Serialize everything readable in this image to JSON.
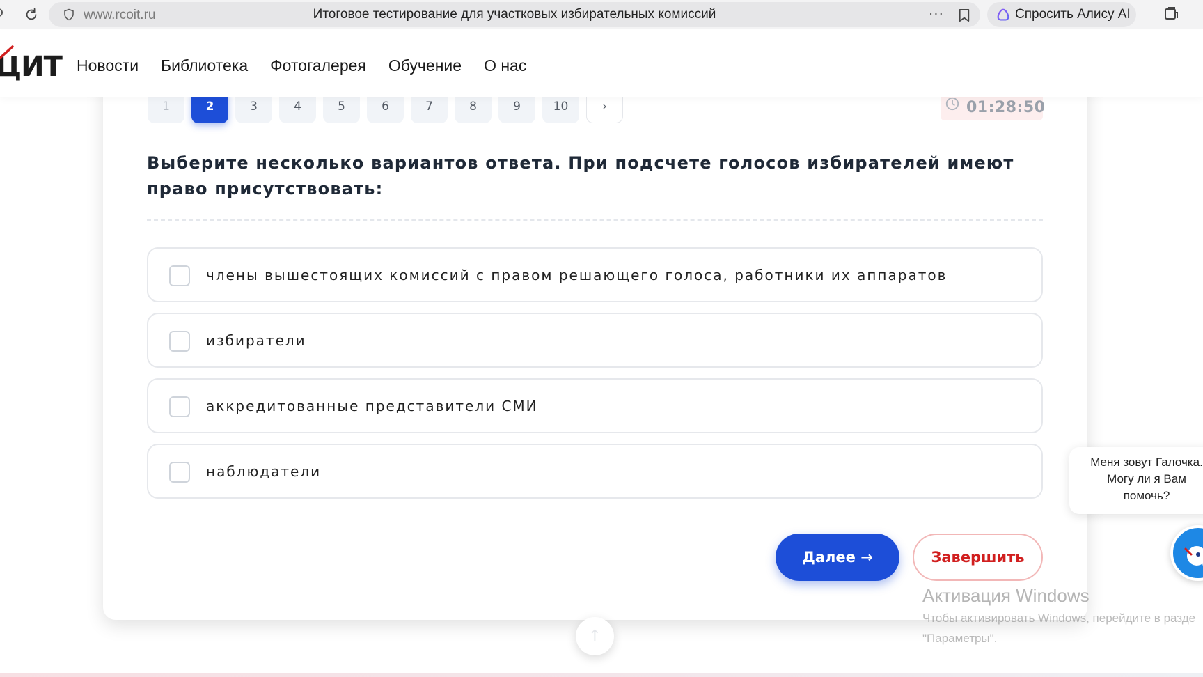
{
  "browser": {
    "url": "www.rcoit.ru",
    "title": "Итоговое тестирование для участковых избирательных комиссий",
    "more_label": "···",
    "alice_label": "Спросить Алису AI"
  },
  "site": {
    "logo_text": "ЦИТ",
    "nav": [
      "Новости",
      "Библиотека",
      "Фотогалерея",
      "Обучение",
      "О нас"
    ]
  },
  "quiz": {
    "pages": [
      "1",
      "2",
      "3",
      "4",
      "5",
      "6",
      "7",
      "8",
      "9",
      "10"
    ],
    "current_page": "2",
    "next_page_label": "›",
    "timer": "01:28:50",
    "question": "Выберите несколько вариантов ответа. При подсчете голосов избирателей имеют право присутствовать:",
    "options": [
      "члены вышестоящих комиссий с правом решающего голоса, работники их аппаратов",
      "избиратели",
      "аккредитованные представители СМИ",
      "наблюдатели"
    ],
    "next_button": "Далее →",
    "finish_button": "Завершить"
  },
  "windows_watermark": {
    "title": "Активация Windows",
    "line1": "Чтобы активировать Windows, перейдите в разде",
    "line2": "\"Параметры\"."
  },
  "chat": {
    "line1": "Меня зовут Галочка.",
    "line2": "Могу ли я Вам",
    "line3": "помочь?"
  },
  "scroll_top_label": "↑",
  "colors": {
    "accent": "#1d4ed8",
    "danger": "#d11f1f",
    "timer_bg": "#fdeeee"
  }
}
